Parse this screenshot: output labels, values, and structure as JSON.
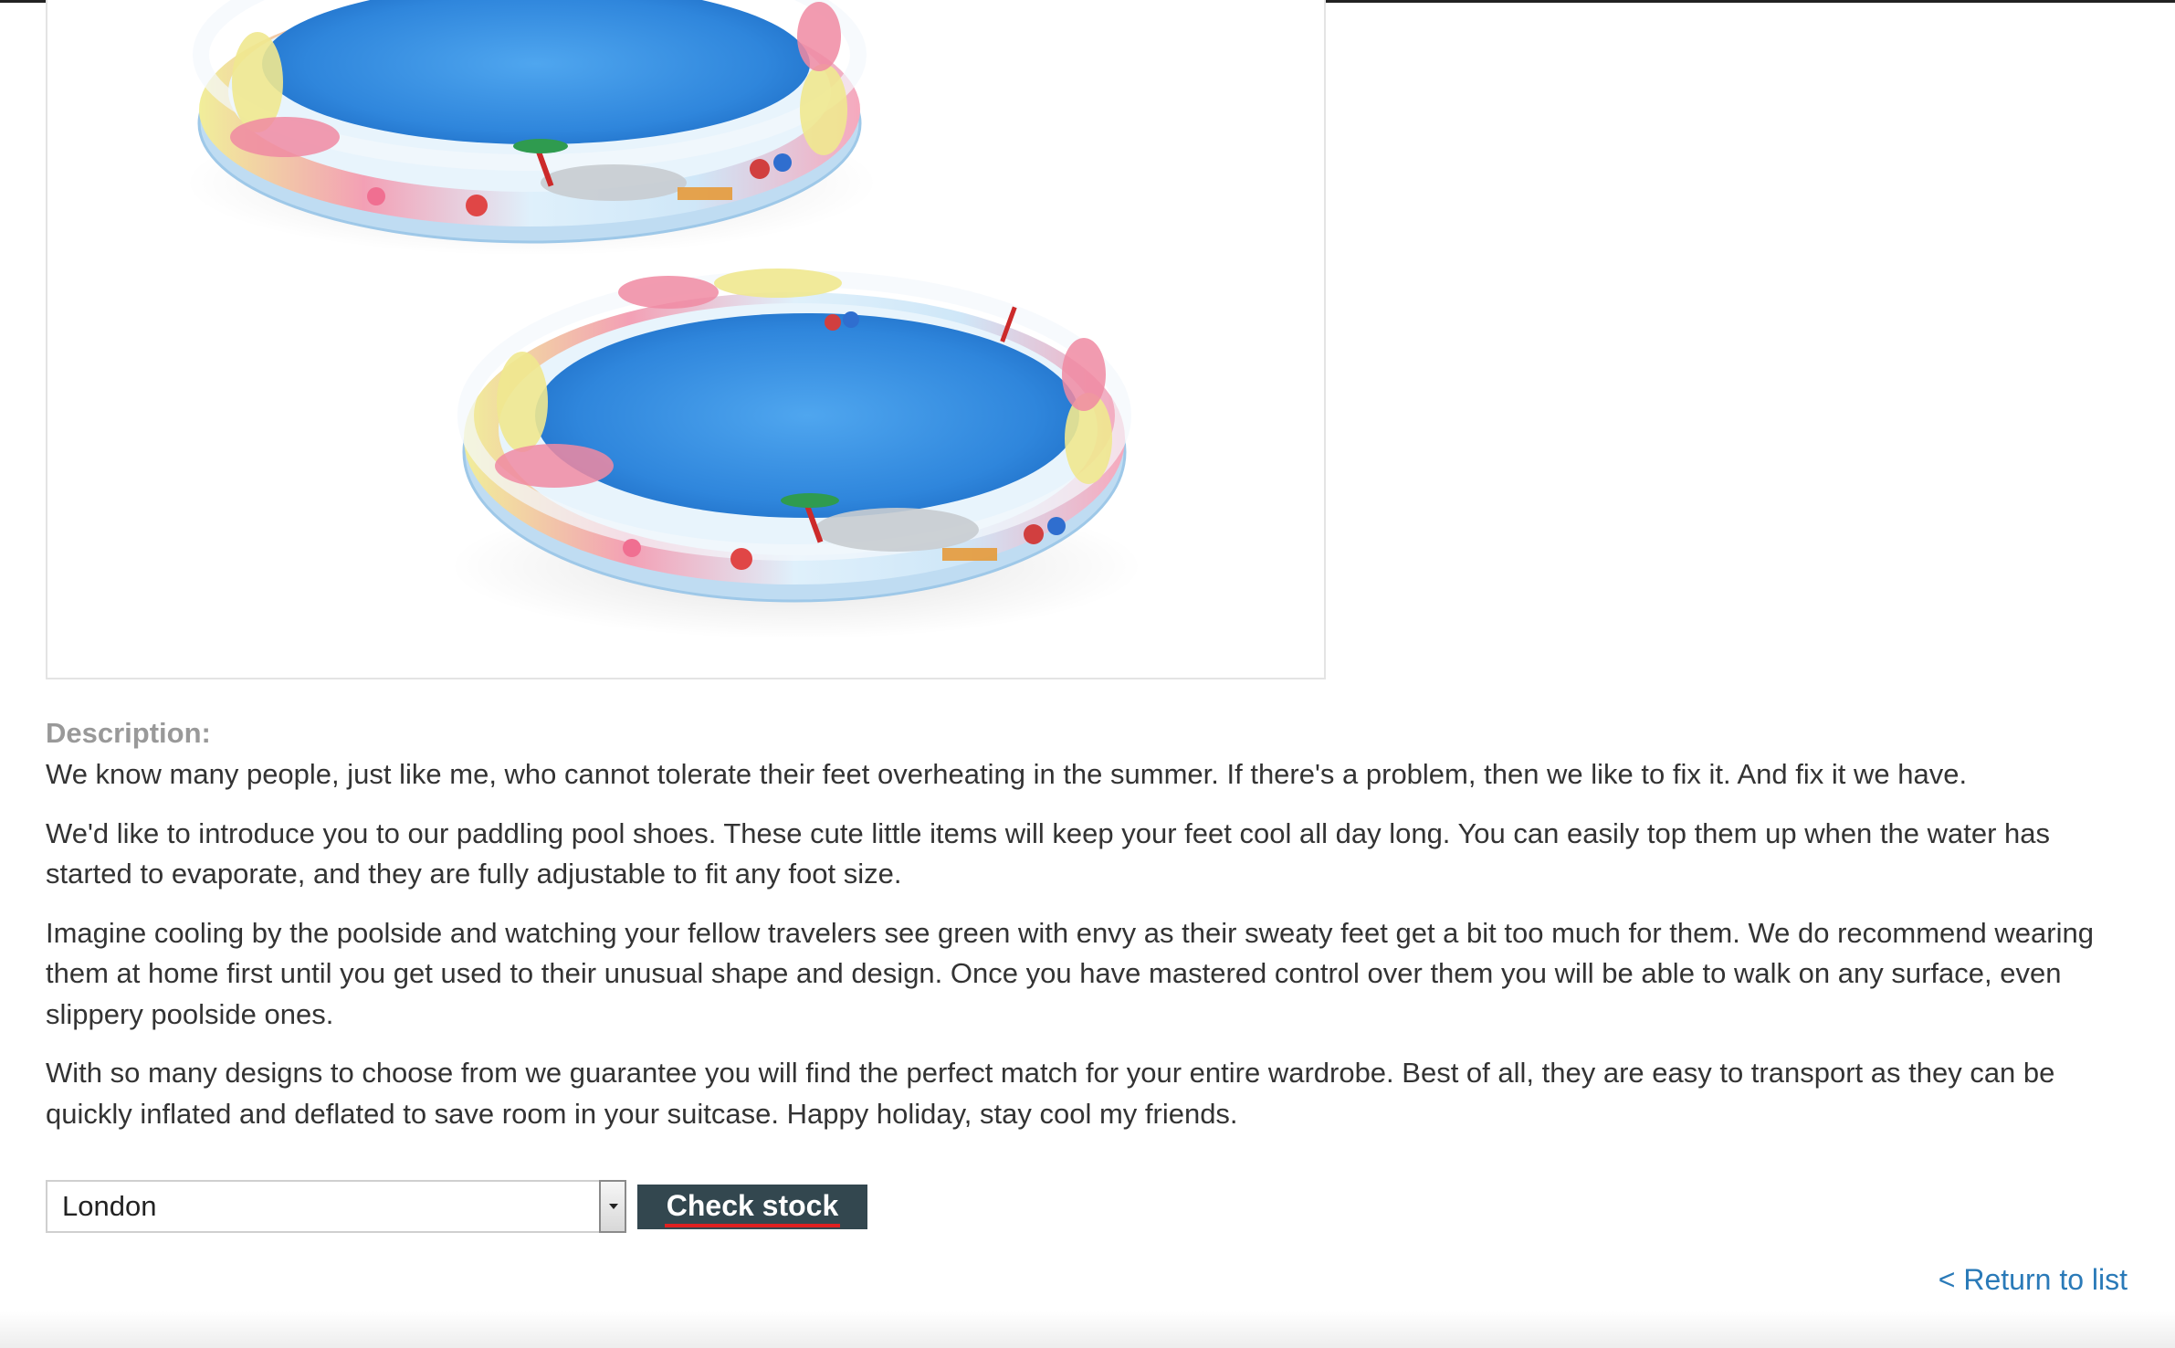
{
  "product": {
    "image_alt": "Two inflatable paddling pool shoes"
  },
  "description": {
    "label": "Description:",
    "paragraphs": [
      "We know many people, just like me, who cannot tolerate their feet overheating in the summer. If there's a problem, then we like to fix it. And fix it we have.",
      "We'd like to introduce you to our paddling pool shoes. These cute little items will keep your feet cool all day long. You can easily top them up when the water has started to evaporate, and they are fully adjustable to fit any foot size.",
      "Imagine cooling by the poolside and watching your fellow travelers see green with envy as their sweaty feet get a bit too much for them. We do recommend wearing them at home first until you get used to their unusual shape and design. Once you have mastered control over them you will be able to walk on any surface, even slippery poolside ones.",
      "With so many designs to choose from we guarantee you will find the perfect match for your entire wardrobe. Best of all, they are easy to transport as they can be quickly inflated and deflated to save room in your suitcase. Happy holiday, stay cool my friends."
    ]
  },
  "stock_check": {
    "store_selected": "London",
    "button_label": "Check stock"
  },
  "navigation": {
    "return_link": "< Return to list"
  },
  "colors": {
    "button_bg": "#33474f",
    "link": "#2a7ab8",
    "label_gray": "#999999",
    "focus_underline": "#e02020"
  },
  "icons": [
    "chevron-down-icon"
  ]
}
